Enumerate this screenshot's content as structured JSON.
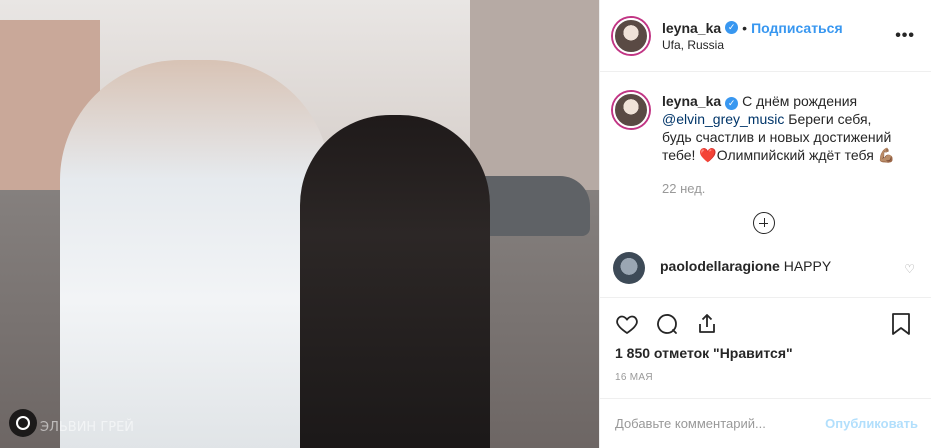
{
  "photo": {
    "watermark": "ЭЛЬВИН ГРЕЙ"
  },
  "header": {
    "username": "leyna_ka",
    "separator": "•",
    "follow_label": "Подписаться",
    "location": "Ufa, Russia",
    "more_label": "•••"
  },
  "caption": {
    "username": "leyna_ka",
    "text_before": "С днём рождения ",
    "mention": "@elvin_grey_music",
    "text_after": " Береги себя, будь счастлив и новых достижений тебе! ",
    "heart_emoji": "❤️",
    "text_end": "Олимпийский ждёт тебя ",
    "muscle_emoji": "💪🏽",
    "time": "22 нед."
  },
  "comment2": {
    "username": "paolodellaragione",
    "text": "HAPPY"
  },
  "actions": {
    "likes": "1 850 отметок \"Нравится\"",
    "date": "16 мая"
  },
  "add_comment": {
    "placeholder": "Добавьте комментарий...",
    "publish_label": "Опубликовать"
  },
  "colors": {
    "accent": "#3897f0",
    "publish_disabled": "#b2dffc",
    "meta_gray": "#999999"
  }
}
